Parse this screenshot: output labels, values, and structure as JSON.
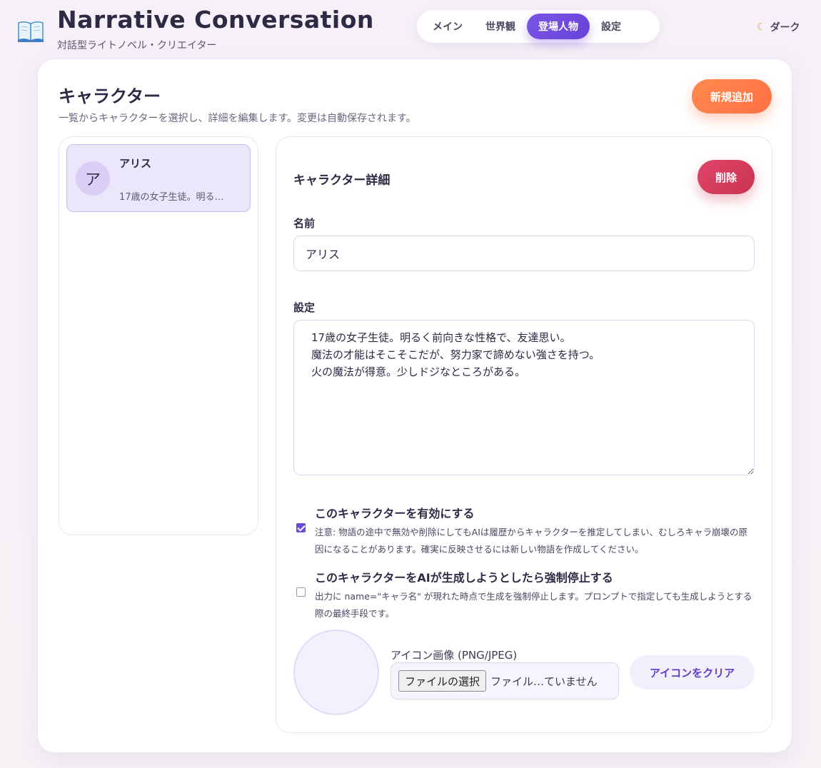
{
  "header": {
    "title": "Narrative Conversation",
    "subtitle": "対話型ライトノベル・クリエイター",
    "icon": "book-icon",
    "nav": [
      {
        "label": "メイン"
      },
      {
        "label": "世界観"
      },
      {
        "label": "登場人物",
        "active": true
      },
      {
        "label": "設定"
      }
    ],
    "theme_icon": "moon-icon",
    "theme_label": "ダーク"
  },
  "page": {
    "title": "キャラクター",
    "description": "一覧からキャラクターを選択し、詳細を編集します。変更は自動保存されます。",
    "add_label": "新規追加"
  },
  "characters": [
    {
      "initial": "ア",
      "name": "アリス",
      "snippet": "17歳の女子生徒。明る…",
      "selected": true
    }
  ],
  "detail": {
    "title": "キャラクター詳細",
    "delete_label": "削除",
    "name_label": "名前",
    "name_value": "アリス",
    "settings_label": "設定",
    "settings_value": "17歳の女子生徒。明るく前向きな性格で、友達思い。\n魔法の才能はそこそこだが、努力家で諦めない強さを持つ。\n火の魔法が得意。少しドジなところがある。",
    "enable": {
      "checked": true,
      "title": "このキャラクターを有効にする",
      "note": "注意: 物語の途中で無効や削除にしてもAIは履歴からキャラクターを推定してしまい、むしろキャラ崩壊の原因になることがあります。確実に反映させるには新しい物語を作成してください。"
    },
    "force_stop": {
      "checked": false,
      "title": "このキャラクターをAIが生成しようとしたら強制停止する",
      "note": "出力に name=\"キャラ名\" が現れた時点で生成を強制停止します。プロンプトで指定しても生成しようとする際の最終手段です。"
    },
    "icon_label": "アイコン画像 (PNG/JPEG)",
    "file_button": "ファイルの選択",
    "file_status": "ファイル…ていません",
    "clear_label": "アイコンをクリア"
  },
  "colors": {
    "accent": "#6b4bdb",
    "add": "#ff7a45",
    "delete": "#d63c5e"
  }
}
